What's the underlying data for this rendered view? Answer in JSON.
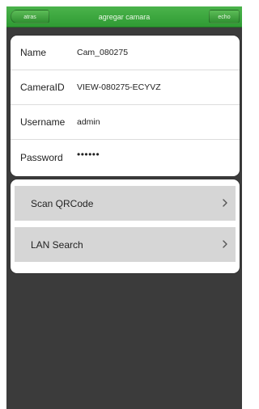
{
  "header": {
    "back_label": "atras",
    "title": "agregar camara",
    "done_label": "echo"
  },
  "form": {
    "name_label": "Name",
    "name_value": "Cam_080275",
    "cameraid_label": "CameraID",
    "cameraid_value": "VIEW-080275-ECYVZ",
    "username_label": "Username",
    "username_value": "admin",
    "password_label": "Password",
    "password_value": "••••••"
  },
  "actions": {
    "scan_label": "Scan QRCode",
    "lan_label": "LAN Search"
  },
  "colors": {
    "header_green": "#2e9a33",
    "background_dark": "#3b3b3b",
    "row_gray": "#d6d6d6"
  }
}
